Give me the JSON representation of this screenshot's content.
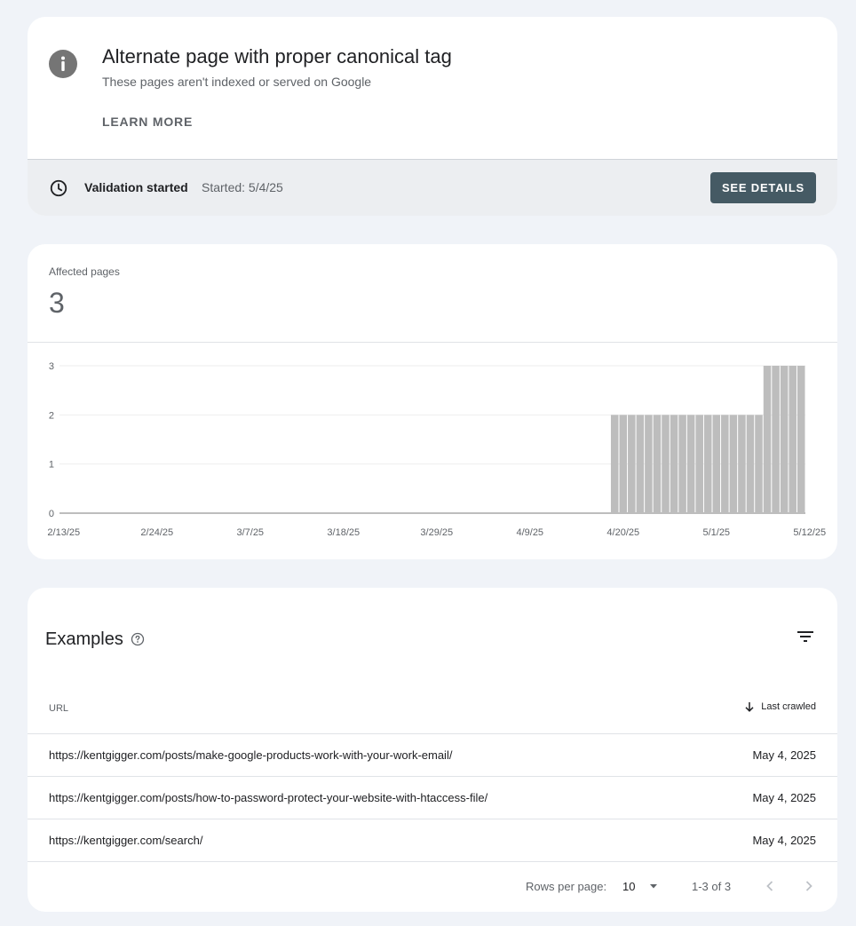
{
  "issue": {
    "title": "Alternate page with proper canonical tag",
    "subtitle": "These pages aren't indexed or served on Google",
    "learn_more": "LEARN MORE"
  },
  "validation": {
    "status": "Validation started",
    "started": "Started: 5/4/25",
    "button": "SEE DETAILS"
  },
  "metric": {
    "label": "Affected pages",
    "value": "3"
  },
  "chart_data": {
    "type": "bar",
    "x_start": "2/13/25",
    "x_end": "5/15/25",
    "x_tick_labels": [
      "2/13/25",
      "2/24/25",
      "3/7/25",
      "3/18/25",
      "3/29/25",
      "4/9/25",
      "4/20/25",
      "5/1/25",
      "5/12/25"
    ],
    "y_ticks": [
      0,
      1,
      2,
      3
    ],
    "ylim": [
      0,
      3
    ],
    "values": [
      0,
      0,
      0,
      0,
      0,
      0,
      0,
      0,
      0,
      0,
      0,
      0,
      0,
      0,
      0,
      0,
      0,
      0,
      0,
      0,
      0,
      0,
      0,
      0,
      0,
      0,
      0,
      0,
      0,
      0,
      0,
      0,
      0,
      0,
      0,
      0,
      0,
      0,
      0,
      0,
      0,
      0,
      0,
      0,
      0,
      0,
      0,
      0,
      0,
      0,
      0,
      0,
      0,
      0,
      0,
      0,
      0,
      0,
      0,
      0,
      0,
      0,
      0,
      0,
      0,
      2,
      2,
      2,
      2,
      2,
      2,
      2,
      2,
      2,
      2,
      2,
      2,
      2,
      2,
      2,
      2,
      2,
      2,
      3,
      3,
      3,
      3,
      3
    ],
    "bar_color": "#bdbdbd",
    "grid": true
  },
  "examples": {
    "title": "Examples",
    "columns": {
      "url": "URL",
      "last_crawled": "Last crawled"
    },
    "rows": [
      {
        "url": "https://kentgigger.com/posts/make-google-products-work-with-your-work-email/",
        "date": "May 4, 2025"
      },
      {
        "url": "https://kentgigger.com/posts/how-to-password-protect-your-website-with-htaccess-file/",
        "date": "May 4, 2025"
      },
      {
        "url": "https://kentgigger.com/search/",
        "date": "May 4, 2025"
      }
    ],
    "pager": {
      "rows_label": "Rows per page:",
      "rows_value": "10",
      "range": "1-3 of 3"
    }
  },
  "colors": {
    "background": "#f0f3f8",
    "button": "#455a64",
    "validation_bar": "#eceef1"
  },
  "icons": [
    "info-icon",
    "clock-icon",
    "help-icon",
    "filter-icon",
    "arrow-down-icon",
    "caret-down-icon",
    "chevron-left-icon",
    "chevron-right-icon"
  ]
}
